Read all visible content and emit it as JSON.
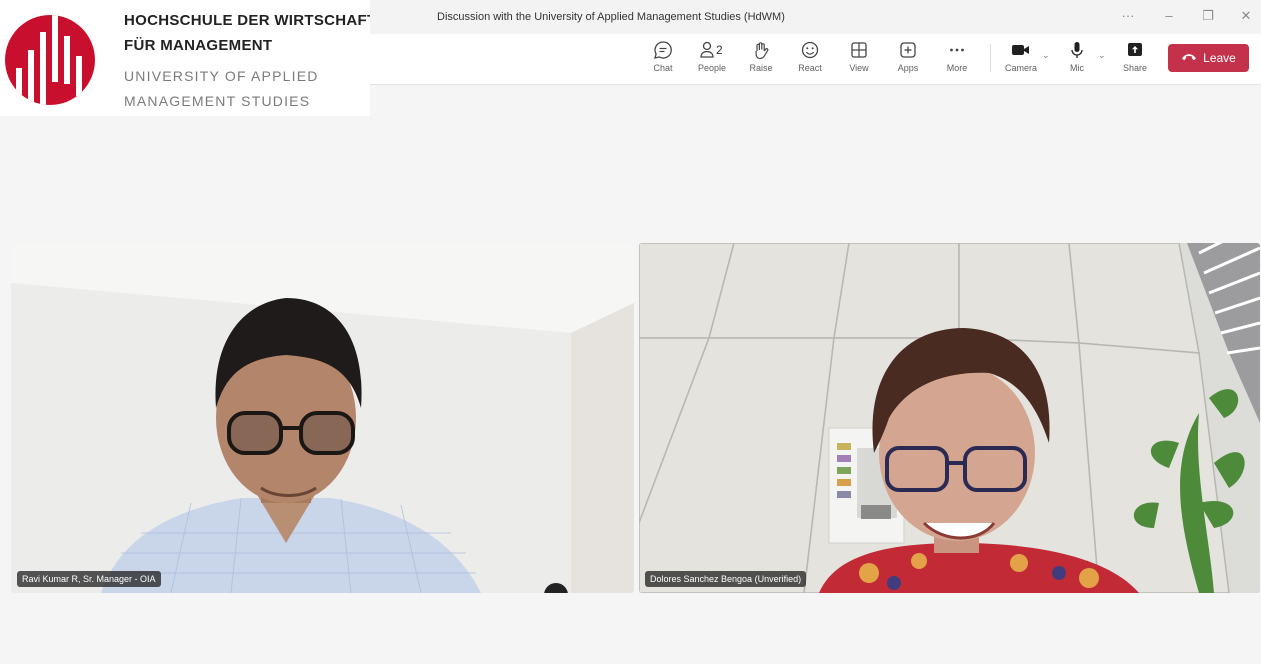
{
  "logo": {
    "line1": "HOCHSCHULE DER WIRTSCHAFT",
    "line2": "FÜR MANAGEMENT",
    "line3": "UNIVERSITY OF APPLIED",
    "line4": "MANAGEMENT STUDIES",
    "brand_color": "#c8102e"
  },
  "window": {
    "title": "Discussion with the University of Applied Management Studies (HdWM)",
    "more_icon": "ellipsis-icon",
    "minimize_icon": "minimize-icon",
    "restore_icon": "restore-icon",
    "close_icon": "close-icon"
  },
  "toolbar": {
    "chat_label": "Chat",
    "people_label": "People",
    "people_count": "2",
    "raise_label": "Raise",
    "react_label": "React",
    "view_label": "View",
    "apps_label": "Apps",
    "more_label": "More",
    "camera_label": "Camera",
    "mic_label": "Mic",
    "share_label": "Share",
    "leave_label": "Leave",
    "leave_color": "#c4314b"
  },
  "participants": [
    {
      "name": "Ravi Kumar R, Sr. Manager - OIA"
    },
    {
      "name": "Dolores Sanchez Bengoa (Unverified)"
    }
  ],
  "colors": {
    "active_speaker_border": "#7f85f5",
    "stage_background": "#f5f5f5"
  }
}
